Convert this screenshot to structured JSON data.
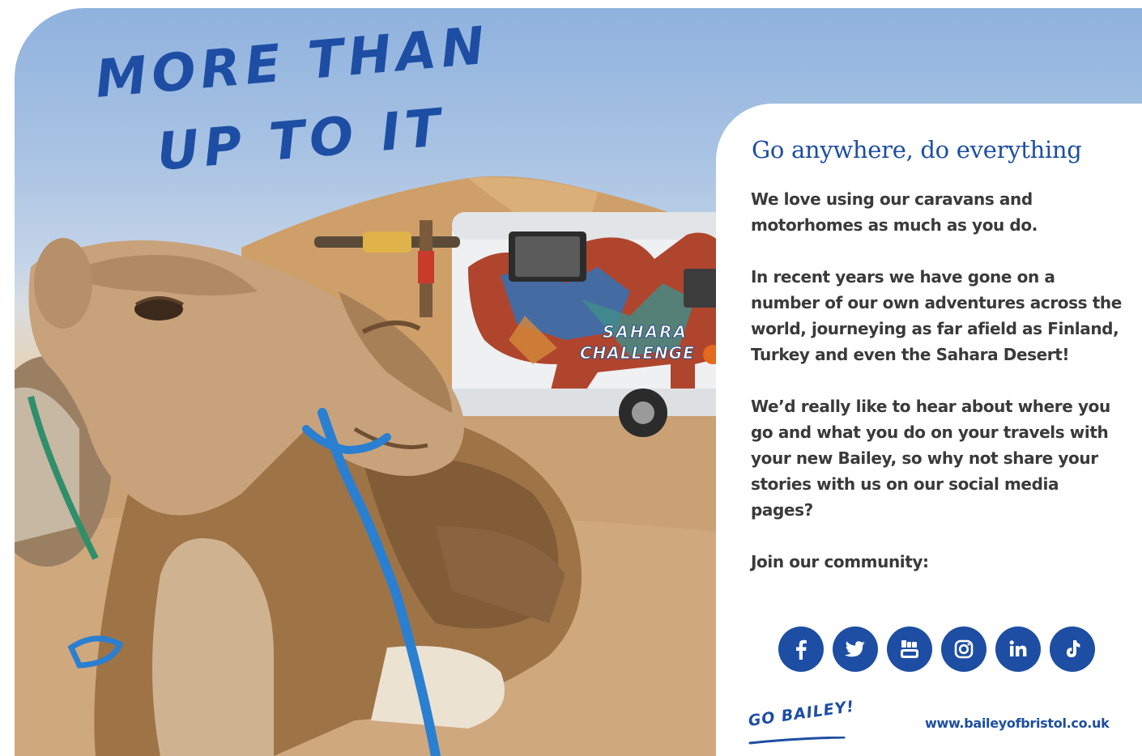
{
  "headline": {
    "line1": "More than",
    "line2": "up to it"
  },
  "photo": {
    "van_label_line1": "Sahara",
    "van_label_line2": "Challenge"
  },
  "card": {
    "title": "Go anywhere, do everything",
    "paragraphs": [
      "We love using our caravans and motorhomes as much as you do.",
      "In recent years we have gone on a number of our own adventures across the world, journeying as far afield as Finland, Turkey and even the Sahara Desert!",
      "We’d really like to hear about where you go and what you do on your travels with your new Bailey, so why not share your stories with us on our social media pages?"
    ],
    "join_label": "Join our community:"
  },
  "socials": [
    {
      "icon": "facebook-icon"
    },
    {
      "icon": "twitter-icon"
    },
    {
      "icon": "youtube-icon",
      "label": "You Tube"
    },
    {
      "icon": "instagram-icon"
    },
    {
      "icon": "linkedin-icon",
      "label": "in"
    },
    {
      "icon": "tiktok-icon"
    }
  ],
  "footer": {
    "logo_text": "Go Bailey!",
    "website": "www.baileyofbristol.co.uk"
  },
  "colors": {
    "brand_blue": "#1d4ea3",
    "body_text": "#3a3a3a"
  }
}
